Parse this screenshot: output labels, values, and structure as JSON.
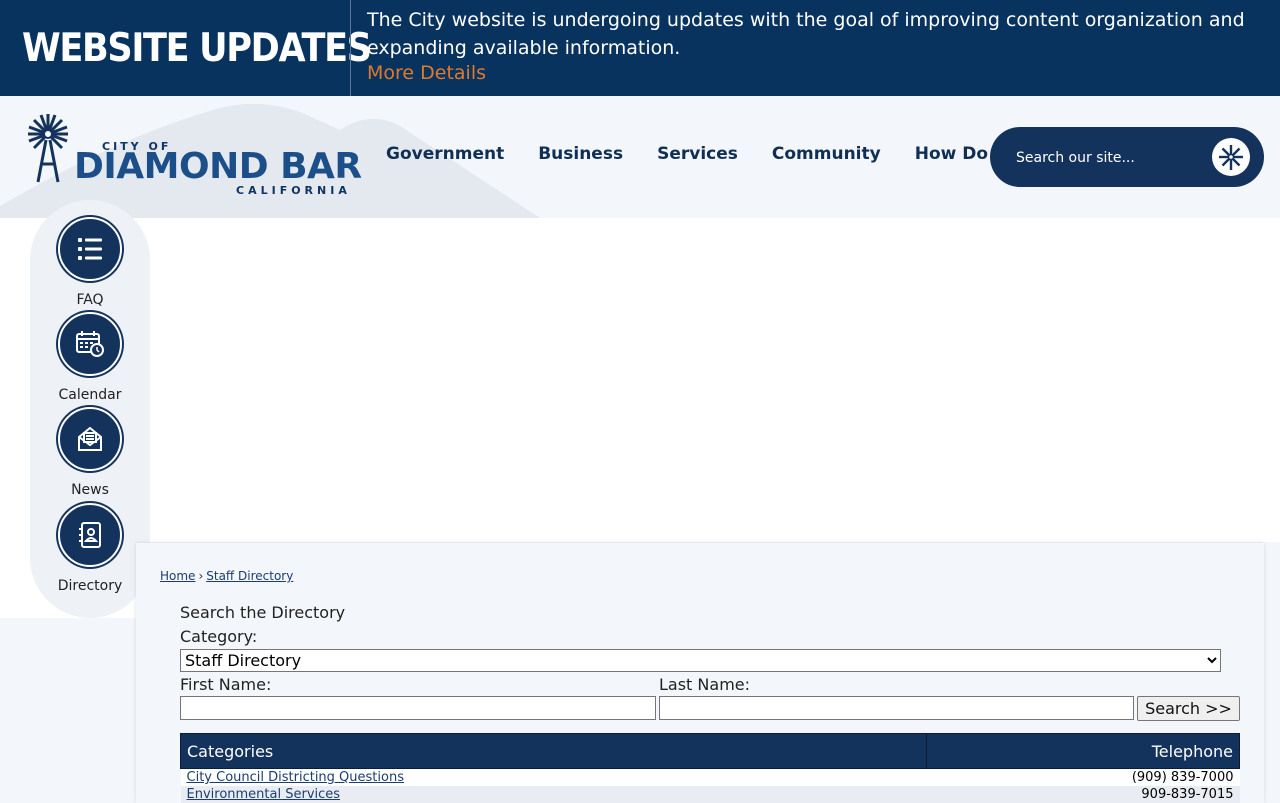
{
  "alert": {
    "title": "WEBSITE UPDATES",
    "message": "The City website is undergoing updates with the goal of improving content organization and expanding available information.",
    "link": "More Details"
  },
  "logo": {
    "city_of": "CITY OF",
    "name": "DIAMOND BAR",
    "state": "CALIFORNIA"
  },
  "nav": [
    "Government",
    "Business",
    "Services",
    "Community",
    "How Do I"
  ],
  "search": {
    "placeholder": "Search our site..."
  },
  "quick_links": [
    {
      "label": "FAQ",
      "icon": "list-icon"
    },
    {
      "label": "Calendar",
      "icon": "calendar-icon"
    },
    {
      "label": "News",
      "icon": "envelope-icon"
    },
    {
      "label": "Directory",
      "icon": "address-book-icon"
    }
  ],
  "breadcrumb": {
    "home": "Home",
    "separator": "›",
    "current": "Staff Directory"
  },
  "form": {
    "title": "Search the Directory",
    "category_label": "Category:",
    "category_selected": "Staff Directory",
    "first_name_label": "First Name:",
    "last_name_label": "Last Name:",
    "first_name_value": "",
    "last_name_value": "",
    "search_button": "Search >>"
  },
  "table": {
    "headers": {
      "categories": "Categories",
      "telephone": "Telephone"
    },
    "rows": [
      {
        "name": "City Council Districting Questions",
        "phone": "(909) 839-7000"
      },
      {
        "name": "Environmental Services",
        "phone": "909-839-7015"
      }
    ]
  },
  "colors": {
    "navy": "#14335c",
    "banner": "#08335f",
    "accent": "#e07a2b"
  }
}
